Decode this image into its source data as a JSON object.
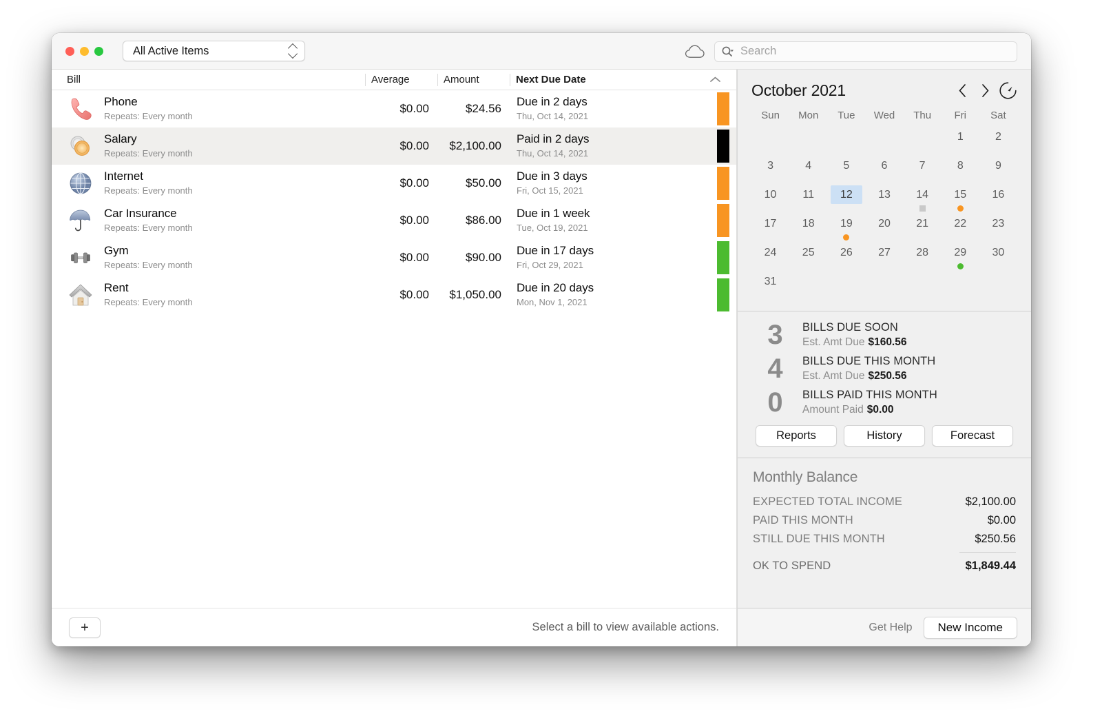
{
  "window": {
    "filter_label": "All Active Items",
    "traffic_lights": [
      "close-red",
      "minimize-yellow",
      "zoom-green"
    ],
    "cloud_icon": "cloud-icon",
    "search_placeholder": "Search",
    "search_value": ""
  },
  "table": {
    "headers": {
      "bill": "Bill",
      "average": "Average",
      "amount": "Amount",
      "next_due": "Next Due Date",
      "sort_direction": "ascending"
    },
    "rows": [
      {
        "icon": "telephone-icon",
        "name": "Phone",
        "repeat": "Repeats: Every month",
        "average": "$0.00",
        "amount": "$24.56",
        "due_main": "Due in 2 days",
        "due_sub": "Thu, Oct 14, 2021",
        "status_color": "#f89522",
        "selected": false
      },
      {
        "icon": "coins-icon",
        "name": "Salary",
        "repeat": "Repeats: Every month",
        "average": "$0.00",
        "amount": "$2,100.00",
        "due_main": "Paid in 2 days",
        "due_sub": "Thu, Oct 14, 2021",
        "status_color": "#000000",
        "selected": true
      },
      {
        "icon": "globe-icon",
        "name": "Internet",
        "repeat": "Repeats: Every month",
        "average": "$0.00",
        "amount": "$50.00",
        "due_main": "Due in 3 days",
        "due_sub": "Fri, Oct 15, 2021",
        "status_color": "#f89522",
        "selected": false
      },
      {
        "icon": "umbrella-icon",
        "name": "Car Insurance",
        "repeat": "Repeats: Every month",
        "average": "$0.00",
        "amount": "$86.00",
        "due_main": "Due in 1 week",
        "due_sub": "Tue, Oct 19, 2021",
        "status_color": "#f89522",
        "selected": false
      },
      {
        "icon": "dumbbell-icon",
        "name": "Gym",
        "repeat": "Repeats: Every month",
        "average": "$0.00",
        "amount": "$90.00",
        "due_main": "Due in 17 days",
        "due_sub": "Fri, Oct 29, 2021",
        "status_color": "#4cbb30",
        "selected": false
      },
      {
        "icon": "house-icon",
        "name": "Rent",
        "repeat": "Repeats: Every month",
        "average": "$0.00",
        "amount": "$1,050.00",
        "due_main": "Due in 20 days",
        "due_sub": "Mon, Nov 1, 2021",
        "status_color": "#4cbb30",
        "selected": false
      }
    ]
  },
  "left_footer": {
    "add_label": "+",
    "hint": "Select a bill to view available actions."
  },
  "calendar": {
    "title": "October 2021",
    "prev_icon": "chevron-left-icon",
    "next_icon": "chevron-right-icon",
    "today_icon": "clock-today-icon",
    "day_names": [
      "Sun",
      "Mon",
      "Tue",
      "Wed",
      "Thu",
      "Fri",
      "Sat"
    ],
    "today": 12,
    "weeks": [
      [
        null,
        null,
        null,
        null,
        null,
        1,
        2
      ],
      [
        3,
        4,
        5,
        6,
        7,
        8,
        9
      ],
      [
        10,
        11,
        12,
        13,
        14,
        15,
        16
      ],
      [
        17,
        18,
        19,
        20,
        21,
        22,
        23
      ],
      [
        24,
        25,
        26,
        27,
        28,
        29,
        30
      ],
      [
        31,
        null,
        null,
        null,
        null,
        null,
        null
      ]
    ],
    "markers": {
      "14": {
        "type": "square",
        "color": "#c9c9c9"
      },
      "15": {
        "type": "dot",
        "color": "#f89522"
      },
      "19": {
        "type": "dot",
        "color": "#f89522"
      },
      "29": {
        "type": "dot",
        "color": "#4cbb30"
      }
    }
  },
  "summary": {
    "items": [
      {
        "count": "3",
        "title": "BILLS DUE SOON",
        "sub_label": "Est. Amt Due",
        "sub_value": "$160.56"
      },
      {
        "count": "4",
        "title": "BILLS DUE THIS MONTH",
        "sub_label": "Est. Amt Due",
        "sub_value": "$250.56"
      },
      {
        "count": "0",
        "title": "BILLS PAID THIS MONTH",
        "sub_label": "Amount Paid",
        "sub_value": "$0.00"
      }
    ],
    "buttons": [
      "Reports",
      "History",
      "Forecast"
    ]
  },
  "balance": {
    "title": "Monthly Balance",
    "rows": [
      {
        "label": "EXPECTED TOTAL INCOME",
        "value": "$2,100.00"
      },
      {
        "label": "PAID THIS MONTH",
        "value": "$0.00"
      },
      {
        "label": "STILL DUE THIS MONTH",
        "value": "$250.56"
      }
    ],
    "total": {
      "label": "OK TO SPEND",
      "value": "$1,849.44"
    }
  },
  "right_footer": {
    "get_help": "Get Help",
    "new_income": "New Income"
  }
}
